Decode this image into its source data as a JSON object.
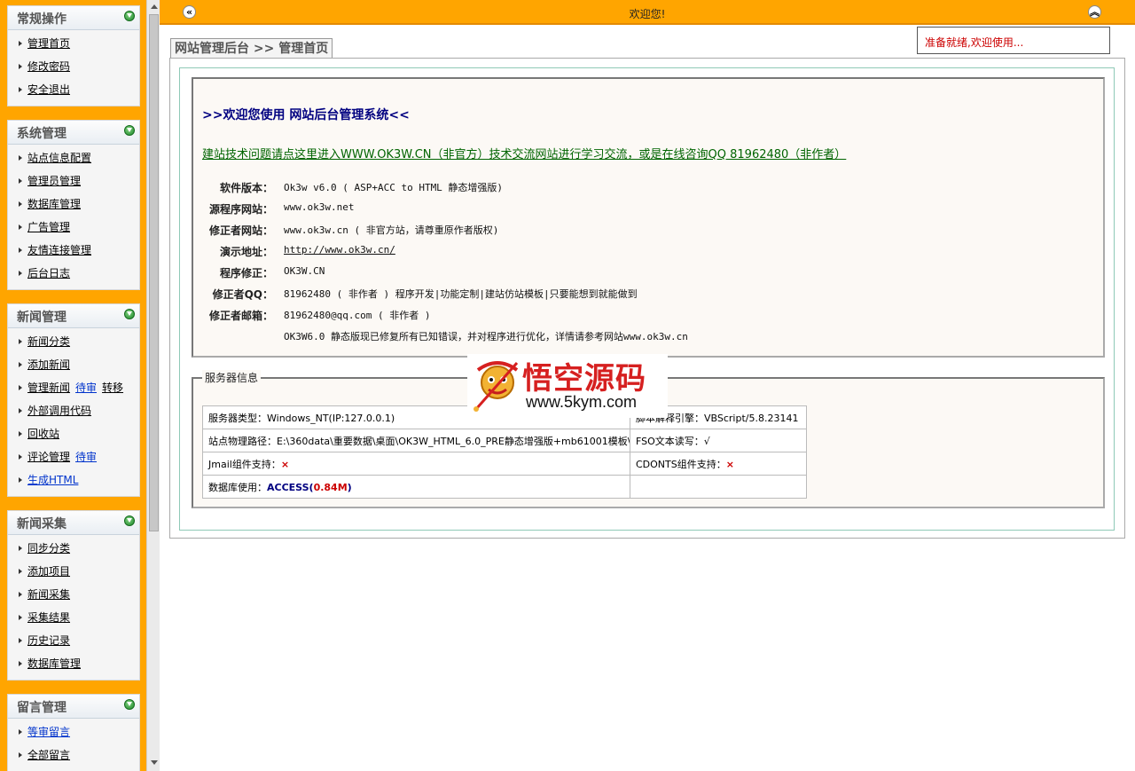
{
  "topbar": {
    "title": "欢迎您!",
    "collapse_left_glyph": "«",
    "collapse_top_glyph": "︽",
    "status": "准备就绪,欢迎使用..."
  },
  "sidebar": [
    {
      "title": "常规操作",
      "items": [
        {
          "label": "管理首页"
        },
        {
          "label": "修改密码"
        },
        {
          "label": "安全退出"
        }
      ]
    },
    {
      "title": "系统管理",
      "items": [
        {
          "label": "站点信息配置"
        },
        {
          "label": "管理员管理"
        },
        {
          "label": "数据库管理"
        },
        {
          "label": "广告管理"
        },
        {
          "label": "友情连接管理"
        },
        {
          "label": "后台日志"
        }
      ]
    },
    {
      "title": "新闻管理",
      "items": [
        {
          "label": "新闻分类"
        },
        {
          "label": "添加新闻"
        },
        {
          "label": "管理新闻",
          "extras": [
            "待审",
            "转移"
          ]
        },
        {
          "label": "外部调用代码"
        },
        {
          "label": "回收站"
        },
        {
          "label": "评论管理",
          "extras": [
            "待审"
          ]
        },
        {
          "label": "生成HTML",
          "blue": true
        }
      ]
    },
    {
      "title": "新闻采集",
      "items": [
        {
          "label": "同步分类"
        },
        {
          "label": "添加项目"
        },
        {
          "label": "新闻采集"
        },
        {
          "label": "采集结果"
        },
        {
          "label": "历史记录"
        },
        {
          "label": "数据库管理"
        }
      ]
    },
    {
      "title": "留言管理",
      "items": [
        {
          "label": "等审留言",
          "blue": true
        },
        {
          "label": "全部留言"
        }
      ]
    }
  ],
  "main": {
    "tab_label": "网站管理后台 >> 管理首页",
    "welcome_title": ">>欢迎您使用 网站后台管理系统<<",
    "help_link": "建站技术问题请点这里进入WWW.OK3W.CN（非官方）技术交流网站进行学习交流，或是在线咨询QQ 81962480（非作者）",
    "info": [
      {
        "label": "软件版本：",
        "value": "Ok3w v6.0 ( ASP+ACC to HTML 静态增强版)"
      },
      {
        "label": "源程序网站：",
        "value": "www.ok3w.net"
      },
      {
        "label": "修正者网站：",
        "value": "www.ok3w.cn ( 非官方站，请尊重原作者版权)"
      },
      {
        "label": "演示地址：",
        "value": "http://www.ok3w.cn/",
        "link": true
      },
      {
        "label": "程序修正：",
        "value": "OK3W.CN"
      },
      {
        "label": "修正者QQ：",
        "value": "81962480 ( 非作者 ) 程序开发|功能定制|建站仿站模板|只要能想到就能做到"
      },
      {
        "label": "修正者邮箱：",
        "value": "81962480@qq.com ( 非作者 )"
      },
      {
        "label": "",
        "value": "OK3W6.0 静态版现已修复所有已知错误，并对程序进行优化，详情请参考网站www.ok3w.cn"
      }
    ],
    "server": {
      "legend": "服务器信息",
      "server_type_label": "服务器类型：",
      "server_type": "Windows_NT(IP:127.0.0.1)",
      "script_engine_label": "脚本解释引擎：",
      "script_engine": "VBScript/5.8.23141",
      "path_label": "站点物理路径：",
      "path": "E:\\360data\\重要数据\\桌面\\OK3W_HTML_6.0_PRE静态增强版+mb61001模板\\",
      "fso_label": "FSO文本读写：",
      "fso": "√",
      "jmail_label": "Jmail组件支持：",
      "jmail": "×",
      "cdonts_label": "CDONTS组件支持：",
      "cdonts": "×",
      "db_label": "数据库使用：",
      "db_name": "ACCESS",
      "db_size": "0.84M"
    }
  },
  "watermark": {
    "title": "悟空源码",
    "url": "www.5kym.com"
  },
  "colors": {
    "frame_orange": "#ffa500",
    "menu_bg": "#f5f5f5",
    "welcome_title": "#000080",
    "help_link": "#006400",
    "status_text": "#cc0000"
  },
  "icons": {
    "menu_toggle": "collapse-circle-icon",
    "menu_item": "right-triangle-icon",
    "collapse_left": "double-chevron-left-icon",
    "collapse_top": "double-chevron-up-icon"
  }
}
